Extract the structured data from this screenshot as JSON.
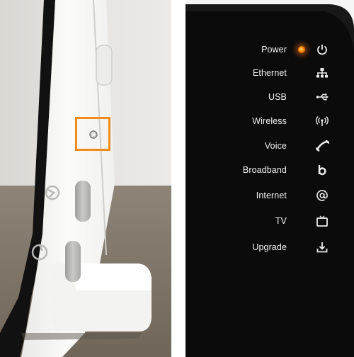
{
  "panel": {
    "items": [
      {
        "label": "Power",
        "icon": "power-icon",
        "led": "on",
        "led_color": "#ff8a1c"
      },
      {
        "label": "Ethernet",
        "icon": "ethernet-icon"
      },
      {
        "label": "USB",
        "icon": "usb-icon"
      },
      {
        "label": "Wireless",
        "icon": "wireless-icon"
      },
      {
        "label": "Voice",
        "icon": "phone-handset-icon"
      },
      {
        "label": "Broadband",
        "icon": "broadband-b-icon"
      },
      {
        "label": "Internet",
        "icon": "at-sign-icon"
      },
      {
        "label": "TV",
        "icon": "tv-icon"
      },
      {
        "label": "Upgrade",
        "icon": "download-icon"
      }
    ]
  },
  "colors": {
    "highlight_box": "#f28a1c",
    "router_body": "#f4f4f2",
    "panel_background": "#0a0a0a"
  }
}
